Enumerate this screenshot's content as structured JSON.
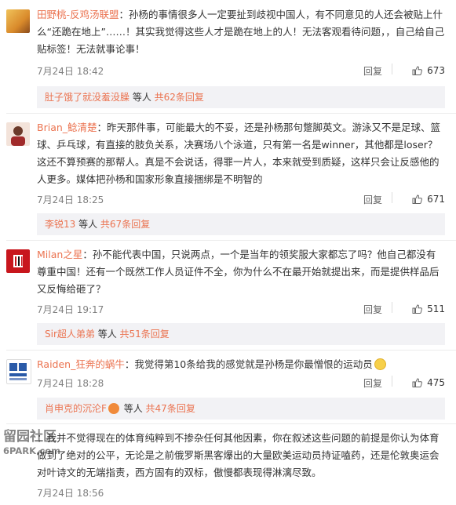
{
  "comments": [
    {
      "user": "田野桃-反鸡汤联盟",
      "text": "：孙杨的事情很多人一定要扯到歧视中国人，有不同意见的人还会被贴上什么“还跪在地上”……！其实我觉得这些人才是跪在地上的人！无法客观看待问题，，自己给自己贴标签！无法就事论事！",
      "time": "7月24日 18:42",
      "reply": "回复",
      "likes": "673",
      "sub_user": "肚子饿了就没羞没臊",
      "sub_mid": " 等人 ",
      "sub_more": "共62条回复"
    },
    {
      "user": "Brian_鲶清楚",
      "text": "：昨天那件事，可能最大的不妥，还是孙杨那句蹩脚英文。游泳又不是足球、篮球、乒乓球，有直接的肢负关系，决赛场八个泳道，只有第一名是winner，其他都是loser？这还不算预赛的那帮人。真是不会说话，得罪一片人，本来就受到质疑，这样只会让反感他的人更多。媒体把孙杨和国家形象直接捆绑是不明智的",
      "time": "7月24日 18:25",
      "reply": "回复",
      "likes": "671",
      "sub_user": "李锐13",
      "sub_mid": " 等人 ",
      "sub_more": "共67条回复"
    },
    {
      "user": "Milan之星",
      "text": "：孙不能代表中国，只说两点，一个是当年的领奖服大家都忘了吗？他自己都没有尊重中国！还有一个既然工作人员证件不全，你为什么不在最开始就提出来，而是提供样品后又反悔给砸了？",
      "time": "7月24日 19:17",
      "reply": "回复",
      "likes": "511",
      "sub_user": "Sir超人弟弟",
      "sub_mid": " 等人 ",
      "sub_more": "共51条回复"
    },
    {
      "user": "Raiden_狂奔的蜗牛",
      "text": "：我觉得第10条给我的感觉就是孙杨是你最憎恨的运动员",
      "time": "7月24日 18:28",
      "reply": "回复",
      "likes": "475",
      "sub_user": "肖申克的沉沦F",
      "sub_mid": " 等人 ",
      "sub_more": "共47条回复"
    },
    {
      "user": "",
      "text": "：我并不觉得现在的体育纯粹到不掺杂任何其他因素，你在叙述这些问题的前提是你认为体育做到了绝对的公平，无论是之前俄罗斯黑客爆出的大量欧美运动员持证嗑药，还是伦敦奥运会对叶诗文的无端指责，西方固有的双标，傲慢都表现得淋漓尽致。",
      "time": "7月24日 18:56"
    }
  ],
  "watermark": {
    "line1": "留园社区",
    "line2": "6PARK.com"
  },
  "colors": {
    "username": "#eb7350",
    "sub_bg": "#f2f2f5",
    "text": "#333333",
    "meta": "#808080"
  }
}
